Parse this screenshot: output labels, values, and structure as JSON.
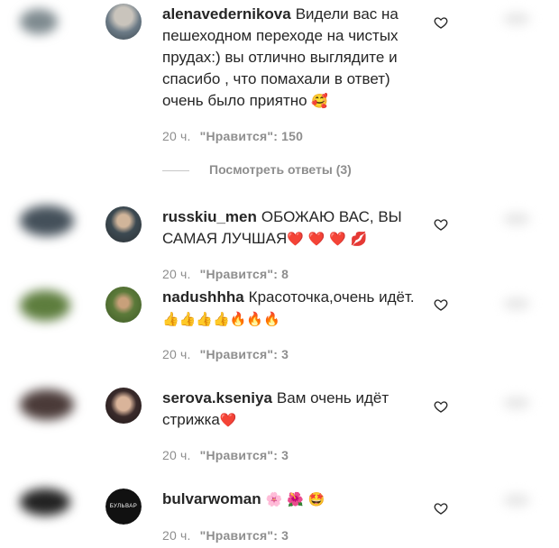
{
  "comments": [
    {
      "username": "alenavedernikova",
      "text": "Видели вас на пешеходном переходе на чистых прудах:) вы отлично выглядите и спасибо , что помахали в ответ) очень было приятно",
      "emoji": "🥰",
      "time": "20 ч.",
      "likes": "\"Нравится\": 150",
      "avatar_color": "#6b7a86"
    },
    {
      "username": "russkiu_men",
      "text": "ОБОЖАЮ ВАС, ВЫ САМАЯ ЛУЧШАЯ",
      "emoji": "❤️ ❤️ ❤️ 💋",
      "time": "20 ч.",
      "likes": "\"Нравится\": 8",
      "avatar_color": "#3d4a52"
    },
    {
      "username": "nadushhha",
      "text": "Красоточка,очень идёт.",
      "emoji": "👍👍👍👍🔥🔥🔥",
      "time": "20 ч.",
      "likes": "\"Нравится\": 3",
      "avatar_color": "#5c7a3a"
    },
    {
      "username": "serova.kseniya",
      "text": "Вам очень идёт стрижка",
      "emoji": "❤️",
      "time": "20 ч.",
      "likes": "\"Нравится\": 3",
      "avatar_color": "#3a2b2b"
    },
    {
      "username": "bulvarwoman",
      "text": "",
      "emoji": "🌸 🌺 🤩",
      "time": "20 ч.",
      "likes": "\"Нравится\": 3",
      "avatar_label": "БУЛЬВАР"
    }
  ],
  "replies_label": "Посмотреть ответы (3)",
  "colors": {
    "text": "#262626",
    "meta": "#8e8e8e",
    "heart": "#262626"
  }
}
